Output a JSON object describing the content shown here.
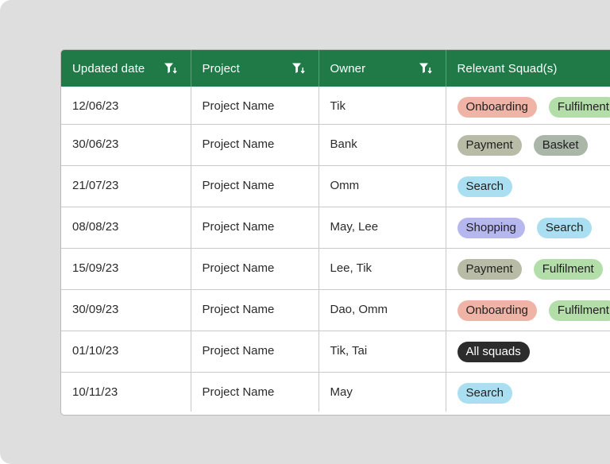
{
  "table": {
    "headers": [
      {
        "label": "Updated date",
        "filter": true
      },
      {
        "label": "Project",
        "filter": true
      },
      {
        "label": "Owner",
        "filter": true
      },
      {
        "label": "Relevant Squad(s)",
        "filter": false
      }
    ],
    "rows": [
      {
        "date": "12/06/23",
        "project": "Project Name",
        "owner": "Tik",
        "squads": [
          {
            "label": "Onboarding",
            "kind": "onboarding"
          },
          {
            "label": "Fulfilment",
            "kind": "fulfilment"
          }
        ]
      },
      {
        "date": "30/06/23",
        "project": "Project Name",
        "owner": "Bank",
        "squads": [
          {
            "label": "Payment",
            "kind": "payment"
          },
          {
            "label": "Basket",
            "kind": "basket"
          }
        ]
      },
      {
        "date": "21/07/23",
        "project": "Project Name",
        "owner": "Omm",
        "squads": [
          {
            "label": "Search",
            "kind": "search"
          }
        ]
      },
      {
        "date": "08/08/23",
        "project": "Project Name",
        "owner": "May, Lee",
        "squads": [
          {
            "label": "Shopping",
            "kind": "shopping"
          },
          {
            "label": "Search",
            "kind": "search"
          }
        ]
      },
      {
        "date": "15/09/23",
        "project": "Project Name",
        "owner": "Lee, Tik",
        "squads": [
          {
            "label": "Payment",
            "kind": "payment"
          },
          {
            "label": "Fulfilment",
            "kind": "fulfilment"
          }
        ]
      },
      {
        "date": "30/09/23",
        "project": "Project Name",
        "owner": "Dao, Omm",
        "squads": [
          {
            "label": "Onboarding",
            "kind": "onboarding"
          },
          {
            "label": "Fulfilment",
            "kind": "fulfilment"
          }
        ]
      },
      {
        "date": "01/10/23",
        "project": "Project Name",
        "owner": "Tik, Tai",
        "squads": [
          {
            "label": "All squads",
            "kind": "all"
          }
        ]
      },
      {
        "date": "10/11/23",
        "project": "Project Name",
        "owner": "May",
        "squads": [
          {
            "label": "Search",
            "kind": "search"
          }
        ]
      }
    ]
  },
  "tag_colors": {
    "onboarding": {
      "bg": "#efb4a6",
      "fg": "#1f1f1f"
    },
    "fulfilment": {
      "bg": "#b3dea9",
      "fg": "#1f1f1f"
    },
    "payment": {
      "bg": "#b8bba6",
      "fg": "#1f1f1f"
    },
    "basket": {
      "bg": "#a9b6a8",
      "fg": "#1f1f1f"
    },
    "search": {
      "bg": "#a9dff0",
      "fg": "#1f1f1f"
    },
    "shopping": {
      "bg": "#b7b7f0",
      "fg": "#1f1f1f"
    },
    "all": {
      "bg": "#2c2c2c",
      "fg": "#ffffff"
    }
  },
  "colors": {
    "header_bg": "#1f7a47",
    "page_bg": "#dedede"
  },
  "icons": {
    "filter": "filter-sort-icon"
  }
}
